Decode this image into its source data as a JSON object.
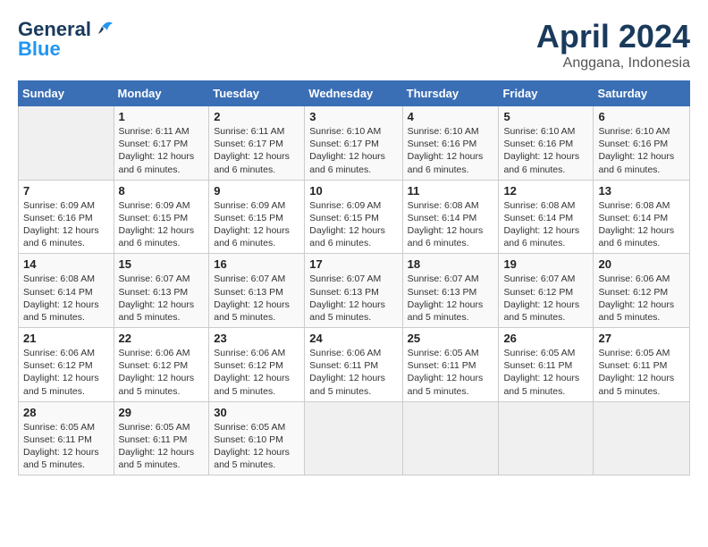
{
  "logo": {
    "line1": "General",
    "line2": "Blue"
  },
  "title": "April 2024",
  "location": "Anggana, Indonesia",
  "days_header": [
    "Sunday",
    "Monday",
    "Tuesday",
    "Wednesday",
    "Thursday",
    "Friday",
    "Saturday"
  ],
  "weeks": [
    [
      {
        "day": "",
        "sunrise": "",
        "sunset": "",
        "daylight": ""
      },
      {
        "day": "1",
        "sunrise": "Sunrise: 6:11 AM",
        "sunset": "Sunset: 6:17 PM",
        "daylight": "Daylight: 12 hours and 6 minutes."
      },
      {
        "day": "2",
        "sunrise": "Sunrise: 6:11 AM",
        "sunset": "Sunset: 6:17 PM",
        "daylight": "Daylight: 12 hours and 6 minutes."
      },
      {
        "day": "3",
        "sunrise": "Sunrise: 6:10 AM",
        "sunset": "Sunset: 6:17 PM",
        "daylight": "Daylight: 12 hours and 6 minutes."
      },
      {
        "day": "4",
        "sunrise": "Sunrise: 6:10 AM",
        "sunset": "Sunset: 6:16 PM",
        "daylight": "Daylight: 12 hours and 6 minutes."
      },
      {
        "day": "5",
        "sunrise": "Sunrise: 6:10 AM",
        "sunset": "Sunset: 6:16 PM",
        "daylight": "Daylight: 12 hours and 6 minutes."
      },
      {
        "day": "6",
        "sunrise": "Sunrise: 6:10 AM",
        "sunset": "Sunset: 6:16 PM",
        "daylight": "Daylight: 12 hours and 6 minutes."
      }
    ],
    [
      {
        "day": "7",
        "sunrise": "Sunrise: 6:09 AM",
        "sunset": "Sunset: 6:16 PM",
        "daylight": "Daylight: 12 hours and 6 minutes."
      },
      {
        "day": "8",
        "sunrise": "Sunrise: 6:09 AM",
        "sunset": "Sunset: 6:15 PM",
        "daylight": "Daylight: 12 hours and 6 minutes."
      },
      {
        "day": "9",
        "sunrise": "Sunrise: 6:09 AM",
        "sunset": "Sunset: 6:15 PM",
        "daylight": "Daylight: 12 hours and 6 minutes."
      },
      {
        "day": "10",
        "sunrise": "Sunrise: 6:09 AM",
        "sunset": "Sunset: 6:15 PM",
        "daylight": "Daylight: 12 hours and 6 minutes."
      },
      {
        "day": "11",
        "sunrise": "Sunrise: 6:08 AM",
        "sunset": "Sunset: 6:14 PM",
        "daylight": "Daylight: 12 hours and 6 minutes."
      },
      {
        "day": "12",
        "sunrise": "Sunrise: 6:08 AM",
        "sunset": "Sunset: 6:14 PM",
        "daylight": "Daylight: 12 hours and 6 minutes."
      },
      {
        "day": "13",
        "sunrise": "Sunrise: 6:08 AM",
        "sunset": "Sunset: 6:14 PM",
        "daylight": "Daylight: 12 hours and 6 minutes."
      }
    ],
    [
      {
        "day": "14",
        "sunrise": "Sunrise: 6:08 AM",
        "sunset": "Sunset: 6:14 PM",
        "daylight": "Daylight: 12 hours and 5 minutes."
      },
      {
        "day": "15",
        "sunrise": "Sunrise: 6:07 AM",
        "sunset": "Sunset: 6:13 PM",
        "daylight": "Daylight: 12 hours and 5 minutes."
      },
      {
        "day": "16",
        "sunrise": "Sunrise: 6:07 AM",
        "sunset": "Sunset: 6:13 PM",
        "daylight": "Daylight: 12 hours and 5 minutes."
      },
      {
        "day": "17",
        "sunrise": "Sunrise: 6:07 AM",
        "sunset": "Sunset: 6:13 PM",
        "daylight": "Daylight: 12 hours and 5 minutes."
      },
      {
        "day": "18",
        "sunrise": "Sunrise: 6:07 AM",
        "sunset": "Sunset: 6:13 PM",
        "daylight": "Daylight: 12 hours and 5 minutes."
      },
      {
        "day": "19",
        "sunrise": "Sunrise: 6:07 AM",
        "sunset": "Sunset: 6:12 PM",
        "daylight": "Daylight: 12 hours and 5 minutes."
      },
      {
        "day": "20",
        "sunrise": "Sunrise: 6:06 AM",
        "sunset": "Sunset: 6:12 PM",
        "daylight": "Daylight: 12 hours and 5 minutes."
      }
    ],
    [
      {
        "day": "21",
        "sunrise": "Sunrise: 6:06 AM",
        "sunset": "Sunset: 6:12 PM",
        "daylight": "Daylight: 12 hours and 5 minutes."
      },
      {
        "day": "22",
        "sunrise": "Sunrise: 6:06 AM",
        "sunset": "Sunset: 6:12 PM",
        "daylight": "Daylight: 12 hours and 5 minutes."
      },
      {
        "day": "23",
        "sunrise": "Sunrise: 6:06 AM",
        "sunset": "Sunset: 6:12 PM",
        "daylight": "Daylight: 12 hours and 5 minutes."
      },
      {
        "day": "24",
        "sunrise": "Sunrise: 6:06 AM",
        "sunset": "Sunset: 6:11 PM",
        "daylight": "Daylight: 12 hours and 5 minutes."
      },
      {
        "day": "25",
        "sunrise": "Sunrise: 6:05 AM",
        "sunset": "Sunset: 6:11 PM",
        "daylight": "Daylight: 12 hours and 5 minutes."
      },
      {
        "day": "26",
        "sunrise": "Sunrise: 6:05 AM",
        "sunset": "Sunset: 6:11 PM",
        "daylight": "Daylight: 12 hours and 5 minutes."
      },
      {
        "day": "27",
        "sunrise": "Sunrise: 6:05 AM",
        "sunset": "Sunset: 6:11 PM",
        "daylight": "Daylight: 12 hours and 5 minutes."
      }
    ],
    [
      {
        "day": "28",
        "sunrise": "Sunrise: 6:05 AM",
        "sunset": "Sunset: 6:11 PM",
        "daylight": "Daylight: 12 hours and 5 minutes."
      },
      {
        "day": "29",
        "sunrise": "Sunrise: 6:05 AM",
        "sunset": "Sunset: 6:11 PM",
        "daylight": "Daylight: 12 hours and 5 minutes."
      },
      {
        "day": "30",
        "sunrise": "Sunrise: 6:05 AM",
        "sunset": "Sunset: 6:10 PM",
        "daylight": "Daylight: 12 hours and 5 minutes."
      },
      {
        "day": "",
        "sunrise": "",
        "sunset": "",
        "daylight": ""
      },
      {
        "day": "",
        "sunrise": "",
        "sunset": "",
        "daylight": ""
      },
      {
        "day": "",
        "sunrise": "",
        "sunset": "",
        "daylight": ""
      },
      {
        "day": "",
        "sunrise": "",
        "sunset": "",
        "daylight": ""
      }
    ]
  ]
}
